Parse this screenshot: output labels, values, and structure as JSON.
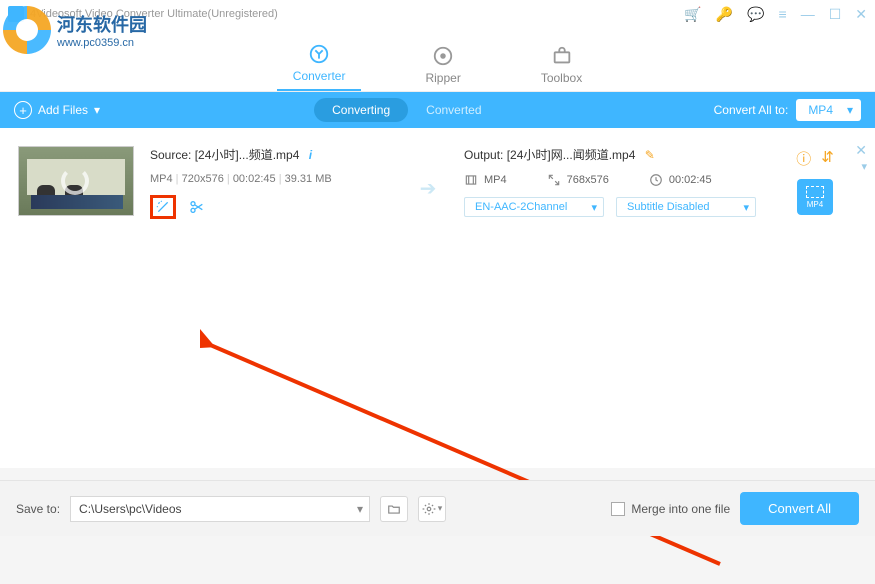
{
  "window": {
    "title": "4Videosoft Video Converter Ultimate(Unregistered)"
  },
  "watermark": {
    "title": "河东软件园",
    "url": "www.pc0359.cn"
  },
  "nav": {
    "converter": "Converter",
    "ripper": "Ripper",
    "toolbox": "Toolbox"
  },
  "toolbar": {
    "add_files": "Add Files",
    "converting": "Converting",
    "converted": "Converted",
    "convert_all_to": "Convert All to:",
    "format": "MP4"
  },
  "item": {
    "source_label": "Source:",
    "source_file": "[24小时]...频道.mp4",
    "meta": {
      "format": "MP4",
      "res": "720x576",
      "dur": "00:02:45",
      "size": "39.31 MB"
    },
    "output_label": "Output:",
    "output_file": "[24小时]网...闻频道.mp4",
    "out": {
      "format": "MP4",
      "res": "768x576",
      "dur": "00:02:45"
    },
    "audio_sel": "EN-AAC-2Channel",
    "subtitle_sel": "Subtitle Disabled",
    "preset": "MP4"
  },
  "bottom": {
    "save_to": "Save to:",
    "path": "C:\\Users\\pc\\Videos",
    "merge": "Merge into one file",
    "convert_all": "Convert All"
  }
}
